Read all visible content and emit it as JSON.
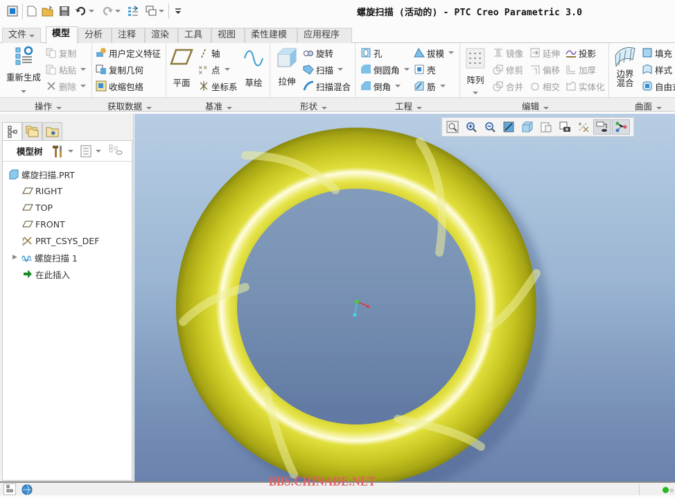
{
  "window": {
    "title": "螺旋扫描 (活动的) - PTC Creo Parametric 3.0"
  },
  "quick_access": [
    {
      "icon": "app-window-icon"
    },
    {
      "icon": "new-file-icon"
    },
    {
      "icon": "open-folder-icon"
    },
    {
      "icon": "save-icon"
    },
    {
      "icon": "undo-icon"
    },
    {
      "icon": "redo-icon"
    },
    {
      "icon": "regenerate-icon"
    },
    {
      "icon": "windows-icon"
    },
    {
      "icon": "customize-dropdown-icon"
    }
  ],
  "tabs": [
    {
      "label": "文件",
      "dropdown": true
    },
    {
      "label": "模型",
      "active": true
    },
    {
      "label": "分析"
    },
    {
      "label": "注释"
    },
    {
      "label": "渲染"
    },
    {
      "label": "工具"
    },
    {
      "label": "视图"
    },
    {
      "label": "柔性建模"
    },
    {
      "label": "应用程序"
    }
  ],
  "ribbon": {
    "groups": [
      {
        "label": "操作",
        "items": [
          {
            "label": "重新生成",
            "icon": "regenerate-icon",
            "big": true
          },
          {
            "label": "复制",
            "icon": "copy-icon",
            "disabled": true
          },
          {
            "label": "粘贴",
            "icon": "paste-icon",
            "disabled": true
          },
          {
            "label": "删除",
            "icon": "delete-icon",
            "disabled": true
          }
        ]
      },
      {
        "label": "获取数据",
        "items": [
          {
            "label": "用户定义特征",
            "icon": "udf-icon"
          },
          {
            "label": "复制几何",
            "icon": "copy-geometry-icon"
          },
          {
            "label": "收缩包络",
            "icon": "shrinkwrap-icon"
          }
        ]
      },
      {
        "label": "基准",
        "items": [
          {
            "label": "平面",
            "icon": "plane-icon",
            "big": true
          },
          {
            "label": "轴",
            "icon": "axis-icon"
          },
          {
            "label": "点",
            "icon": "point-icon"
          },
          {
            "label": "坐标系",
            "icon": "csys-icon"
          },
          {
            "label": "草绘",
            "icon": "sketch-icon",
            "big": true
          }
        ]
      },
      {
        "label": "形状",
        "items": [
          {
            "label": "拉伸",
            "icon": "extrude-icon",
            "big": true
          },
          {
            "label": "旋转",
            "icon": "revolve-icon"
          },
          {
            "label": "扫描",
            "icon": "sweep-icon"
          },
          {
            "label": "扫描混合",
            "icon": "swept-blend-icon"
          }
        ]
      },
      {
        "label": "工程",
        "items": [
          {
            "label": "孔",
            "icon": "hole-icon"
          },
          {
            "label": "倒圆角",
            "icon": "round-icon"
          },
          {
            "label": "倒角",
            "icon": "chamfer-icon"
          },
          {
            "label": "拔模",
            "icon": "draft-icon"
          },
          {
            "label": "壳",
            "icon": "shell-icon"
          },
          {
            "label": "筋",
            "icon": "rib-icon"
          }
        ]
      },
      {
        "label": "编辑",
        "items": [
          {
            "label": "阵列",
            "icon": "pattern-icon",
            "big": true
          },
          {
            "label": "镜像",
            "icon": "mirror-icon",
            "disabled": true
          },
          {
            "label": "修剪",
            "icon": "trim-icon",
            "disabled": true
          },
          {
            "label": "合并",
            "icon": "merge-icon",
            "disabled": true
          },
          {
            "label": "延伸",
            "icon": "extend-icon",
            "disabled": true
          },
          {
            "label": "偏移",
            "icon": "offset-icon",
            "disabled": true
          },
          {
            "label": "相交",
            "icon": "intersect-icon",
            "disabled": true
          },
          {
            "label": "投影",
            "icon": "project-icon"
          },
          {
            "label": "加厚",
            "icon": "thicken-icon",
            "disabled": true
          },
          {
            "label": "实体化",
            "icon": "solidify-icon",
            "disabled": true
          }
        ]
      },
      {
        "label": "曲面",
        "items": [
          {
            "label": "边界\n混合",
            "label_line1": "边界",
            "label_line2": "混合",
            "icon": "boundary-blend-icon",
            "big": true
          },
          {
            "label": "填充",
            "icon": "fill-icon"
          },
          {
            "label": "样式",
            "icon": "style-icon"
          },
          {
            "label": "自由式",
            "visible_text": "自由式",
            "icon": "freestyle-icon"
          }
        ]
      }
    ]
  },
  "left_panel": {
    "tabs": [
      {
        "icon": "model-tree-icon",
        "active": true
      },
      {
        "icon": "folder-browser-icon"
      },
      {
        "icon": "favorites-icon"
      }
    ],
    "header": {
      "title": "模型树",
      "settings_icon": "tools-icon",
      "show_icon": "show-list-icon",
      "filter_icon": "tree-filter-icon"
    },
    "tree": [
      {
        "label": "螺旋扫描.PRT",
        "icon": "part-icon",
        "level": 0
      },
      {
        "label": "RIGHT",
        "icon": "datum-plane-icon",
        "level": 1
      },
      {
        "label": "TOP",
        "icon": "datum-plane-icon",
        "level": 1
      },
      {
        "label": "FRONT",
        "icon": "datum-plane-icon",
        "level": 1
      },
      {
        "label": "PRT_CSYS_DEF",
        "icon": "csys-icon",
        "level": 1
      },
      {
        "label": "螺旋扫描 1",
        "icon": "helical-sweep-icon",
        "level": 1,
        "expandable": true
      },
      {
        "label": "在此插入",
        "icon": "insert-here-arrow-icon",
        "level": 1
      }
    ]
  },
  "view_toolbar": [
    {
      "name": "refit",
      "icon": "zoom-fit-icon"
    },
    {
      "name": "zoom-in",
      "icon": "zoom-in-icon"
    },
    {
      "name": "zoom-out",
      "icon": "zoom-out-icon"
    },
    {
      "name": "repaint",
      "icon": "repaint-icon"
    },
    {
      "name": "display-style",
      "icon": "display-style-icon"
    },
    {
      "name": "saved-orientations",
      "icon": "saved-views-icon"
    },
    {
      "name": "view-manager",
      "icon": "view-manager-icon"
    },
    {
      "name": "datum-display",
      "icon": "datum-display-icon"
    },
    {
      "name": "annotation-display",
      "icon": "annotation-display-icon",
      "active": true
    },
    {
      "name": "spin-center",
      "icon": "spin-center-icon",
      "active": true
    }
  ],
  "viewport": {
    "model": "helical-sweep-torus",
    "model_color": "#d4d21c",
    "background_top": "#b7cde3",
    "background_bottom": "#6a82ad"
  },
  "watermark": "BBS.CHINADE.NET",
  "status": {
    "indicator_color": "#22bb22"
  }
}
